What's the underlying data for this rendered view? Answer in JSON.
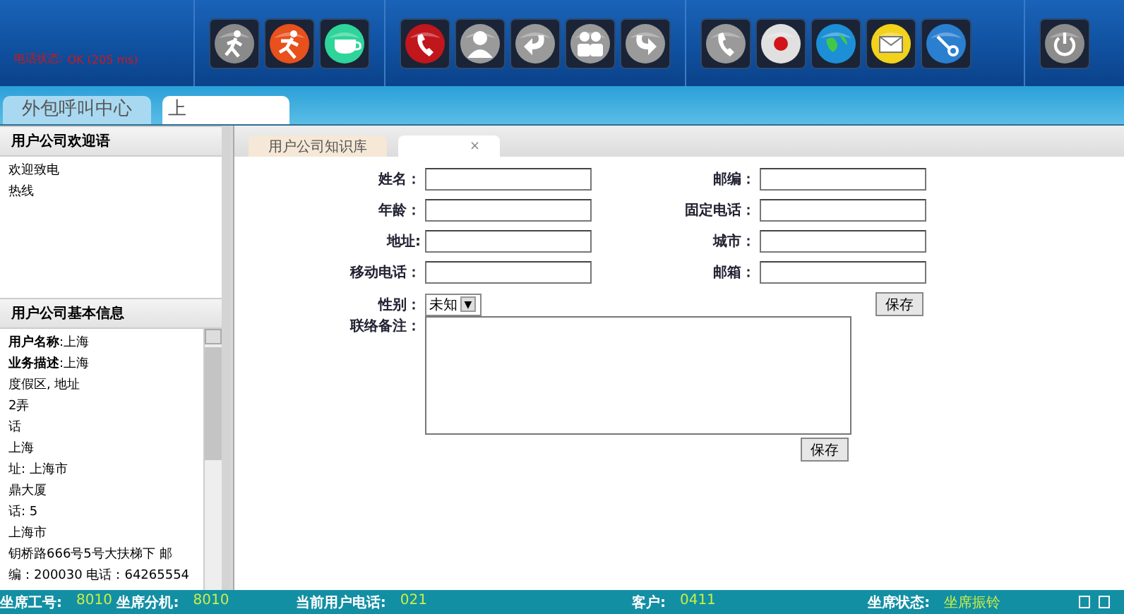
{
  "header": {
    "status_label": "电话状态:",
    "status_value": "OK (205 ms)",
    "toolbar_groups": [
      [
        {
          "kind": "walk"
        },
        {
          "kind": "run"
        },
        {
          "kind": "cup"
        }
      ],
      [
        {
          "kind": "hangup"
        },
        {
          "kind": "person"
        },
        {
          "kind": "transfer"
        },
        {
          "kind": "group"
        },
        {
          "kind": "back"
        }
      ],
      [
        {
          "kind": "phone"
        },
        {
          "kind": "record"
        },
        {
          "kind": "globe"
        },
        {
          "kind": "mail"
        },
        {
          "kind": "tools"
        }
      ],
      [
        {
          "kind": "power"
        }
      ]
    ]
  },
  "tabs": [
    {
      "label": "外包呼叫中心",
      "selected": false
    },
    {
      "label": "上",
      "selected": true
    }
  ],
  "sidebar": {
    "sections": [
      {
        "title": "用户公司欢迎语",
        "lines": [
          "欢迎致电",
          "热线"
        ],
        "kind": "plain"
      },
      {
        "title": "用户公司基本信息",
        "lines": [
          "**用户名称**:上海",
          "**业务描述**:上海",
          "度假区, 地址",
          "2弄",
          "话",
          "上海",
          "址: 上海市",
          "鼎大厦",
          "话: 5",
          "上海市",
          "钥桥路666号5号大扶梯下 邮",
          "编：200030 电话：64265554"
        ],
        "kind": "scroll"
      }
    ]
  },
  "subtabs": [
    {
      "label": "用户公司知识库",
      "selected": false
    },
    {
      "selected": true,
      "close": "×"
    }
  ],
  "form": {
    "fields": [
      {
        "label": "姓名：",
        "kind": "text"
      },
      {
        "label": "邮编：",
        "kind": "text"
      },
      {
        "label": "年龄：",
        "kind": "text"
      },
      {
        "label": "固定电话：",
        "kind": "text"
      },
      {
        "label": "地址:",
        "kind": "text"
      },
      {
        "label": "城市：",
        "kind": "text"
      },
      {
        "label": "移动电话：",
        "kind": "text"
      },
      {
        "label": "邮箱：",
        "kind": "text"
      },
      {
        "label": "性别：",
        "kind": "select",
        "value": "未知",
        "arrow": "▼"
      }
    ],
    "save_button": "保存",
    "notes_label": "联络备注：",
    "notes_save_button": "保存"
  },
  "status_bar": [
    {
      "label": "坐席工号:",
      "value": "8010"
    },
    {
      "label": "坐席分机:",
      "value": "8010"
    },
    {
      "label": "当前用户电话:",
      "value": "021"
    },
    {
      "label": "客户:",
      "value": "0411"
    },
    {
      "label": "坐席状态:",
      "value": "坐席振铃"
    }
  ]
}
